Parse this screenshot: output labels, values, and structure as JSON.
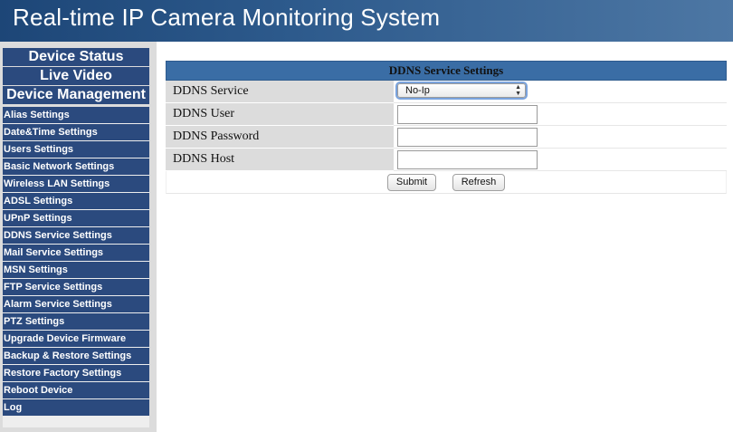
{
  "header": {
    "title": "Real-time IP Camera Monitoring System"
  },
  "main_nav": {
    "items": [
      {
        "label": "Device Status"
      },
      {
        "label": "Live Video"
      },
      {
        "label": "Device Management"
      }
    ]
  },
  "submenu": {
    "items": [
      {
        "label": "Alias Settings"
      },
      {
        "label": "Date&Time Settings"
      },
      {
        "label": "Users Settings"
      },
      {
        "label": "Basic Network Settings"
      },
      {
        "label": "Wireless LAN Settings"
      },
      {
        "label": "ADSL Settings"
      },
      {
        "label": "UPnP Settings"
      },
      {
        "label": "DDNS Service Settings"
      },
      {
        "label": "Mail Service Settings"
      },
      {
        "label": "MSN Settings"
      },
      {
        "label": "FTP Service Settings"
      },
      {
        "label": "Alarm Service Settings"
      },
      {
        "label": "PTZ Settings"
      },
      {
        "label": "Upgrade Device Firmware"
      },
      {
        "label": "Backup & Restore Settings"
      },
      {
        "label": "Restore Factory Settings"
      },
      {
        "label": "Reboot Device"
      },
      {
        "label": "Log"
      }
    ]
  },
  "panel": {
    "title": "DDNS Service Settings",
    "fields": {
      "service": {
        "label": "DDNS Service",
        "selected": "No-Ip"
      },
      "user": {
        "label": "DDNS User",
        "value": ""
      },
      "password": {
        "label": "DDNS Password",
        "value": ""
      },
      "host": {
        "label": "DDNS Host",
        "value": ""
      }
    },
    "buttons": {
      "submit": "Submit",
      "refresh": "Refresh"
    }
  },
  "colors": {
    "nav_bg": "#2b4a7e",
    "panel_header": "#3a6da5",
    "sidebar_bg": "#dcdcdc"
  },
  "icons": {
    "select_arrows": "up-down-arrows-icon"
  }
}
